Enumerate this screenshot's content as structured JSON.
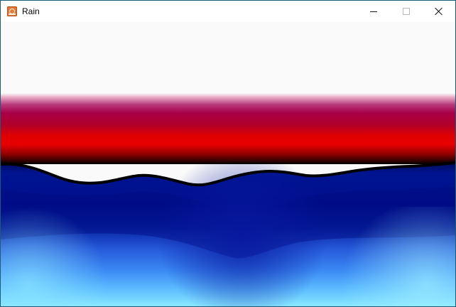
{
  "window": {
    "title": "Rain",
    "app_icon": "rain-app-icon",
    "controls": {
      "minimize_icon": "minimize-icon",
      "maximize_icon": "maximize-icon",
      "close_icon": "close-icon"
    }
  },
  "colors": {
    "sky": "#fafafa",
    "band_magenta": "#a80048",
    "band_red": "#e80000",
    "horizon_black": "#000000",
    "water_dark_blue": "#000e8c",
    "water_light_blue": "#78d8ff"
  }
}
